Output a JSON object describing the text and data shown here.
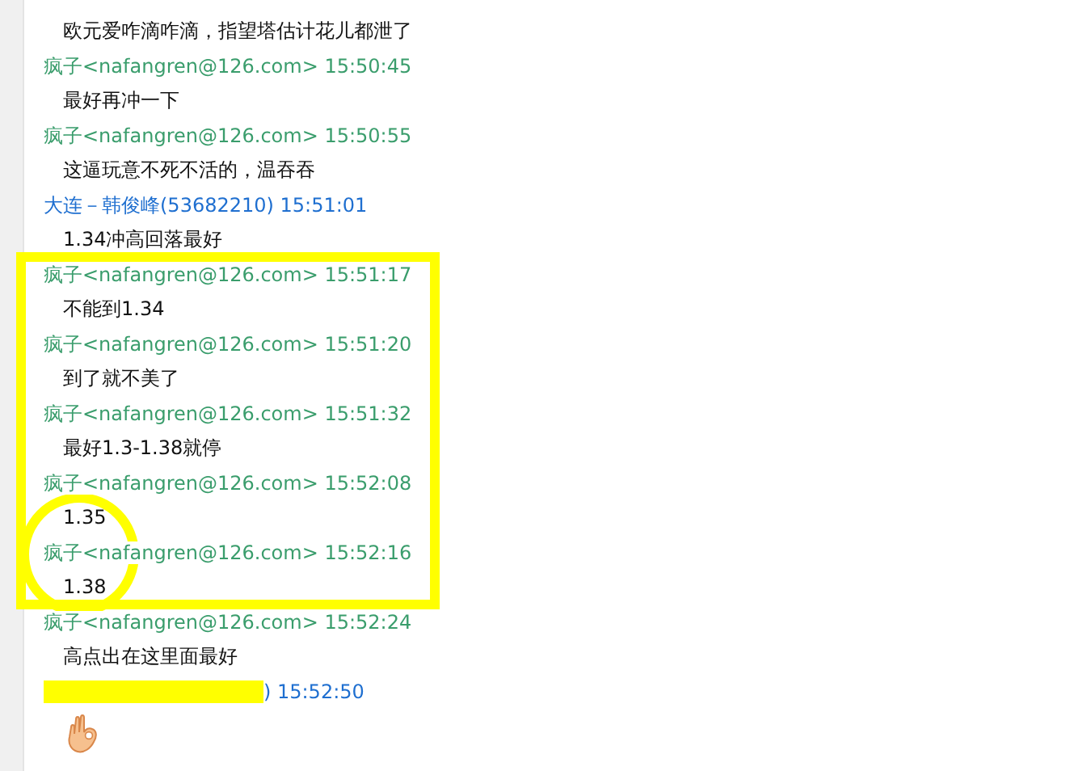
{
  "messages": [
    {
      "kind": "text",
      "text": "欧元爱咋滴咋滴，指望塔估计花儿都泄了"
    },
    {
      "kind": "header",
      "text": "疯子<nafangren@126.com> 15:50:45",
      "color": "#3a9d6c"
    },
    {
      "kind": "text",
      "text": "最好再冲一下"
    },
    {
      "kind": "header",
      "text": "疯子<nafangren@126.com> 15:50:55",
      "color": "#3a9d6c"
    },
    {
      "kind": "text",
      "text": "这逼玩意不死不活的，温吞吞"
    },
    {
      "kind": "header",
      "text": "大连－韩俊峰(53682210) 15:51:01",
      "color": "#1f6fd0"
    },
    {
      "kind": "text",
      "text": "1.34冲高回落最好"
    },
    {
      "kind": "header",
      "text": "疯子<nafangren@126.com> 15:51:17",
      "color": "#3a9d6c"
    },
    {
      "kind": "text",
      "text": "不能到1.34"
    },
    {
      "kind": "header",
      "text": "疯子<nafangren@126.com> 15:51:20",
      "color": "#3a9d6c"
    },
    {
      "kind": "text",
      "text": "到了就不美了"
    },
    {
      "kind": "header",
      "text": "疯子<nafangren@126.com> 15:51:32",
      "color": "#3a9d6c"
    },
    {
      "kind": "text",
      "text": "最好1.3-1.38就停"
    },
    {
      "kind": "header",
      "text": "疯子<nafangren@126.com> 15:52:08",
      "color": "#3a9d6c"
    },
    {
      "kind": "text",
      "text": "1.35"
    },
    {
      "kind": "header",
      "text": "疯子<nafangren@126.com> 15:52:16",
      "color": "#3a9d6c"
    },
    {
      "kind": "text",
      "text": "1.38"
    },
    {
      "kind": "header",
      "text": "疯子<nafangren@126.com> 15:52:24",
      "color": "#3a9d6c"
    },
    {
      "kind": "text",
      "text": "高点出在这里面最好"
    },
    {
      "kind": "redacted_header",
      "text": ") 15:52:50",
      "color": "#1f6fd0"
    },
    {
      "kind": "emoji"
    }
  ],
  "highlight_rectangle": true,
  "highlight_circle": true
}
